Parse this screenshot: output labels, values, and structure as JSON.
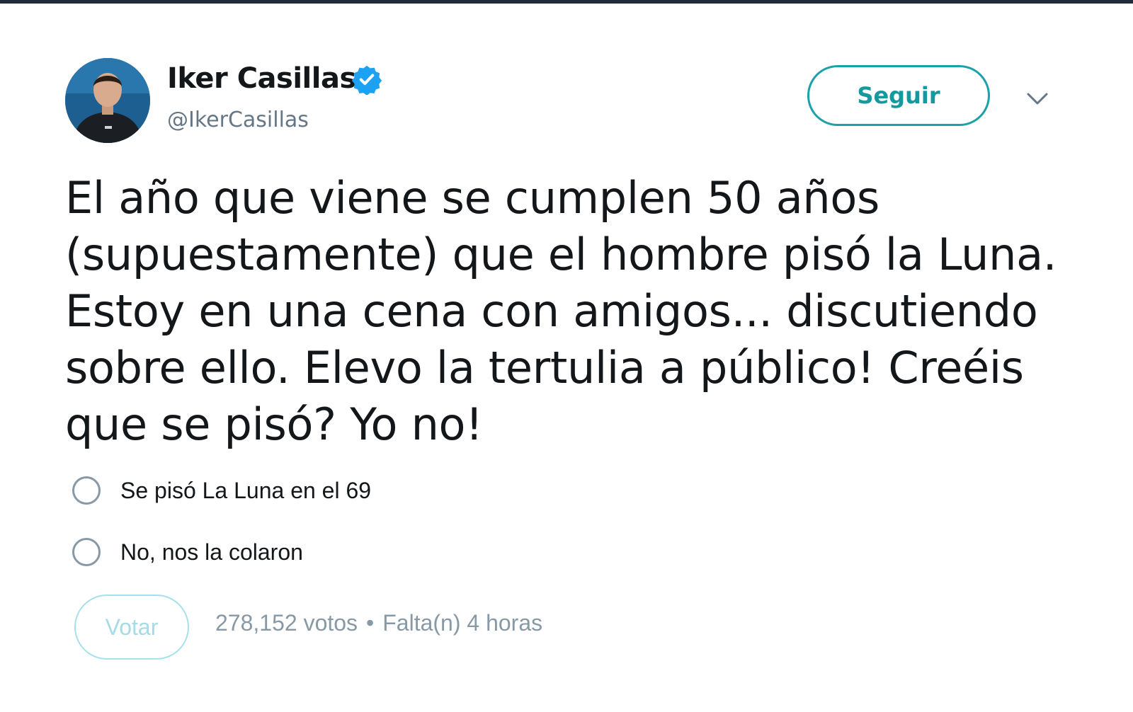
{
  "author": {
    "name": "Iker Casillas",
    "handle": "@IkerCasillas",
    "verified": true,
    "verified_color": "#1da1f2"
  },
  "header": {
    "follow_label": "Seguir",
    "menu_icon": "chevron-down-icon",
    "accent_color": "#1da1a8"
  },
  "tweet": {
    "text": "El año que viene se cumplen 50 años\n(supuestamente) que el hombre pisó la Luna.\nEstoy en una cena con amigos... discutiendo\nsobre ello. Elevo la tertulia a público! Creéis\nque se pisó? Yo no!"
  },
  "poll": {
    "options": [
      {
        "label": "Se pisó La Luna en el 69",
        "selected": false
      },
      {
        "label": "No, nos la colaron",
        "selected": false
      }
    ],
    "vote_label": "Votar",
    "votes": "278,152 votos",
    "separator": "•",
    "time_left": "Falta(n) 4 horas"
  }
}
